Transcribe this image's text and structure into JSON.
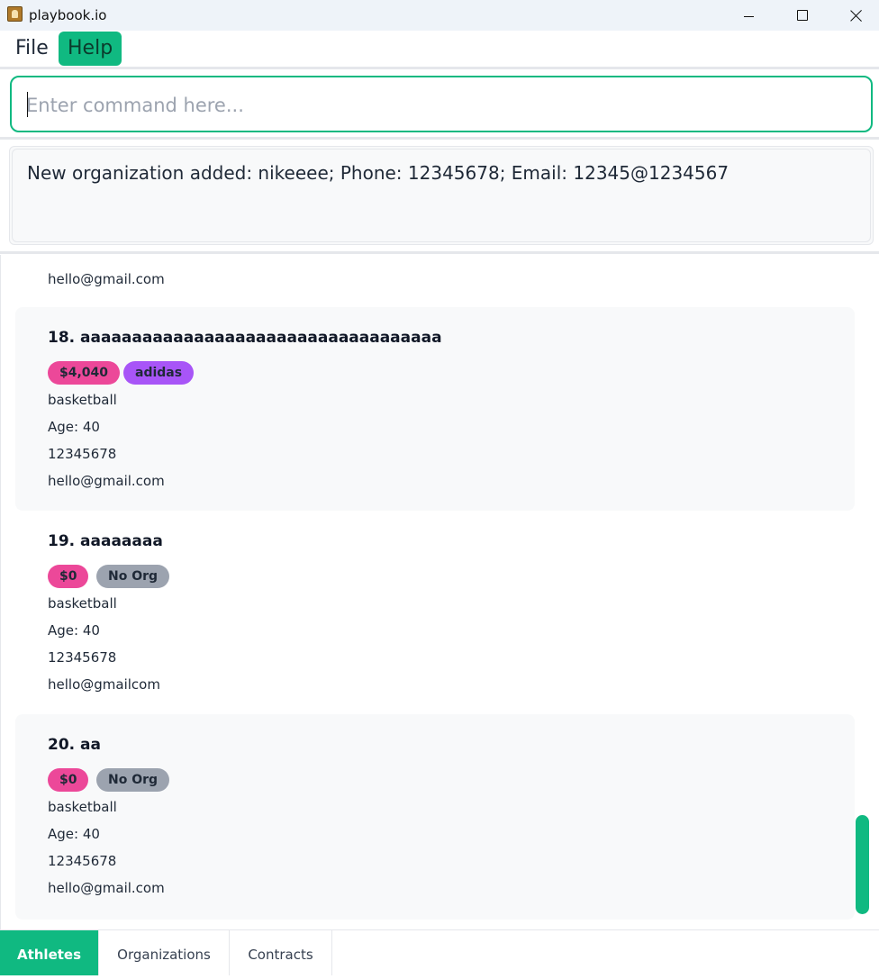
{
  "window": {
    "title": "playbook.io",
    "icon": "app-icon"
  },
  "menu": {
    "file_label": "File",
    "help_label": "Help"
  },
  "command": {
    "placeholder": "Enter command here...",
    "value": ""
  },
  "result": {
    "message": "New organization added: nikeeee; Phone: 12345678; Email: 12345@1234567"
  },
  "athletes": {
    "partial_top_email": "hello@gmail.com",
    "items": [
      {
        "title": "18. aaaaaaaaaaaaaaaaaaaaaaaaaaaaaaaaaaa",
        "price": "$4,040",
        "org": "adidas",
        "sport": "basketball",
        "age": "Age: 40",
        "phone": "12345678",
        "email": "hello@gmail.com"
      },
      {
        "title": "19. aaaaaaaa",
        "price": "$0",
        "org": "No Org",
        "sport": "basketball",
        "age": "Age: 40",
        "phone": "12345678",
        "email": "hello@gmailcom"
      },
      {
        "title": "20. aa",
        "price": "$0",
        "org": "No Org",
        "sport": "basketball",
        "age": "Age: 40",
        "phone": "12345678",
        "email": "hello@gmail.com"
      }
    ]
  },
  "tabs": [
    {
      "label": "Athletes",
      "active": true
    },
    {
      "label": "Organizations",
      "active": false
    },
    {
      "label": "Contracts",
      "active": false
    }
  ],
  "colors": {
    "accent": "#10b981",
    "price_tag": "#ec4899",
    "org_tag": "#a855f7",
    "no_org_tag": "#9ca3af"
  }
}
